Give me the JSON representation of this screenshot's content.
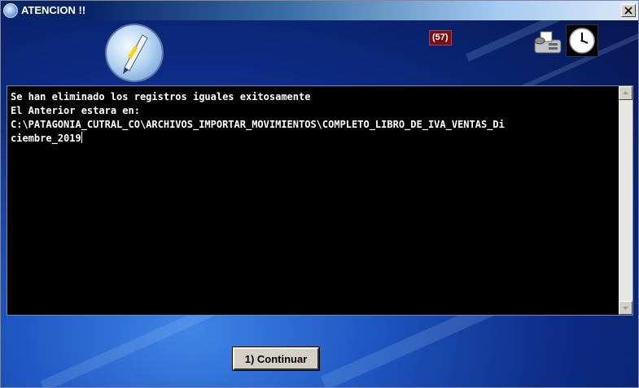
{
  "window": {
    "title": "ATENCION !!"
  },
  "header": {
    "counter": "(57)"
  },
  "message": {
    "lines": [
      "Se han eliminado los registros iguales exitosamente",
      "El Anterior estara en:",
      "C:\\PATAGONIA_CUTRAL_CO\\ARCHIVOS_IMPORTAR_MOVIMIENTOS\\COMPLETO_LIBRO_DE_IVA_VENTAS_Di",
      "ciembre_2019"
    ]
  },
  "actions": {
    "continue_label": "1) Continuar"
  },
  "colors": {
    "titlebar": "#0a246a",
    "message_bg": "#000000",
    "message_text": "#ffffff",
    "badge": "#7a1010"
  },
  "icons": [
    "info-icon",
    "close-icon",
    "logo-icon",
    "fax-icon",
    "clock-icon",
    "scroll-up-icon",
    "scroll-down-icon"
  ]
}
